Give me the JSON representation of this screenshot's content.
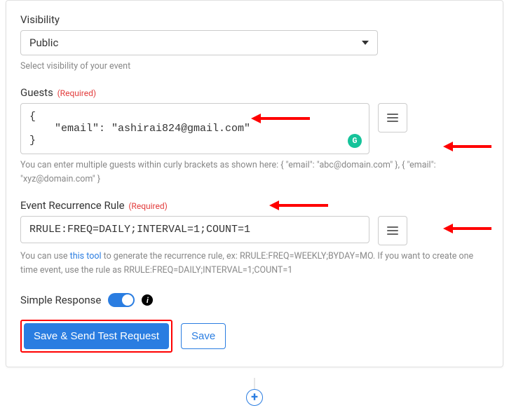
{
  "visibility": {
    "label": "Visibility",
    "value": "Public",
    "helper": "Select visibility of your event"
  },
  "guests": {
    "label": "Guests",
    "required_text": "(Required)",
    "value": "{\n    \"email\": \"ashirai824@gmail.com\"\n}",
    "helper": "You can enter multiple guests within curly brackets as shown here: { \"email\": \"abc@domain.com\" }, { \"email\": \"xyz@domain.com\" }"
  },
  "recurrence": {
    "label": "Event Recurrence Rule",
    "required_text": "(Required)",
    "value": "RRULE:FREQ=DAILY;INTERVAL=1;COUNT=1",
    "helper_before": "You can use ",
    "helper_link": "this tool",
    "helper_after": " to generate the recurrence rule, ex: RRULE:FREQ=WEEKLY;BYDAY=MO. If you want to create one time event, use the rule as RRULE:FREQ=DAILY;INTERVAL=1;COUNT=1"
  },
  "simple_response": {
    "label": "Simple Response",
    "on": true
  },
  "buttons": {
    "primary": "Save & Send Test Request",
    "secondary": "Save"
  },
  "icons": {
    "grammarly": "G",
    "info": "i",
    "plus": "+"
  }
}
